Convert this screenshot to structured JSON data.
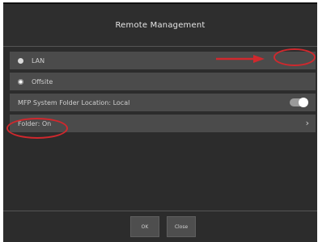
{
  "window": {
    "title": "Remote Management"
  },
  "options": [
    {
      "label": "LAN",
      "selected": false
    },
    {
      "label": "Offsite",
      "selected": true
    }
  ],
  "setting": {
    "label": "MFP System Folder Location: Local",
    "toggle_on": true
  },
  "folder": {
    "label": "Folder: On",
    "chevron": "›"
  },
  "footer": {
    "ok_label": "OK",
    "close_label": "Close"
  },
  "colors": {
    "annotation": "#d0282d",
    "background": "#2c2c2c",
    "row": "#4b4b4b"
  }
}
